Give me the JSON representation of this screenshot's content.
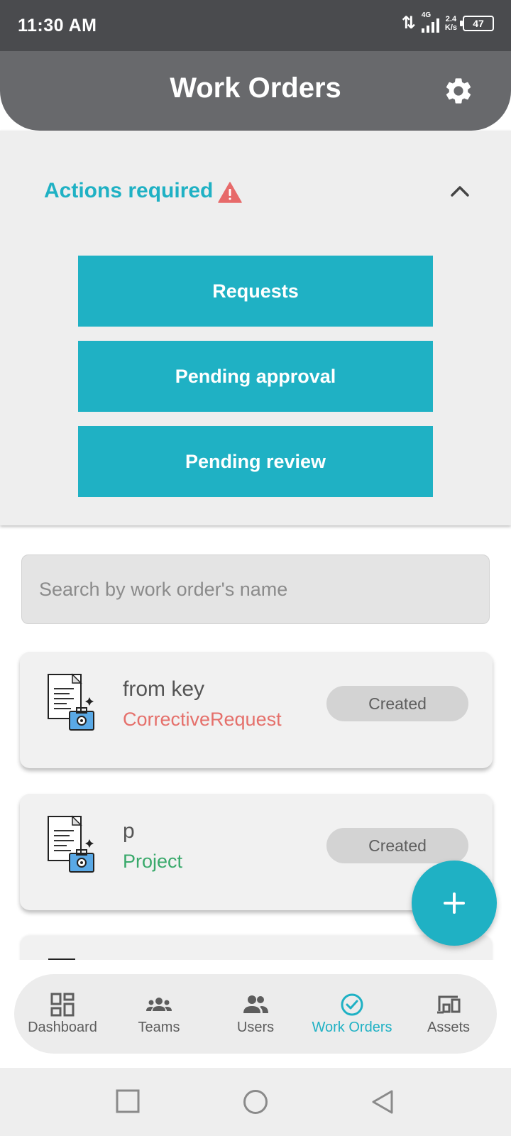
{
  "status_bar": {
    "time": "11:30 AM",
    "network": "4G",
    "speed_value": "2.4",
    "speed_unit": "K/s",
    "battery": "47"
  },
  "app_bar": {
    "title": "Work Orders",
    "settings_icon": "gear-icon"
  },
  "actions": {
    "title": "Actions required",
    "warning_icon": "warning-icon",
    "toggle_icon": "chevron-up-icon",
    "buttons": [
      "Requests",
      "Pending approval",
      "Pending review"
    ]
  },
  "search": {
    "placeholder": "Search by work order's name"
  },
  "work_orders": [
    {
      "name": "from key",
      "type": "CorrectiveRequest",
      "type_color": "#e5706b",
      "status": "Created"
    },
    {
      "name": "p",
      "type": "Project",
      "type_color": "#39a96b",
      "status": "Created"
    }
  ],
  "fab": {
    "icon": "plus-icon"
  },
  "bottom_nav": {
    "active": "Work Orders",
    "items": [
      {
        "label": "Dashboard",
        "icon": "dashboard-icon"
      },
      {
        "label": "Teams",
        "icon": "teams-icon"
      },
      {
        "label": "Users",
        "icon": "users-icon"
      },
      {
        "label": "Work Orders",
        "icon": "check-circle-icon"
      },
      {
        "label": "Assets",
        "icon": "devices-icon"
      }
    ]
  },
  "colors": {
    "accent": "#1fb1c4",
    "app_bar": "#68696c",
    "status_bar": "#4a4b4e",
    "warning": "#e76a6a"
  }
}
